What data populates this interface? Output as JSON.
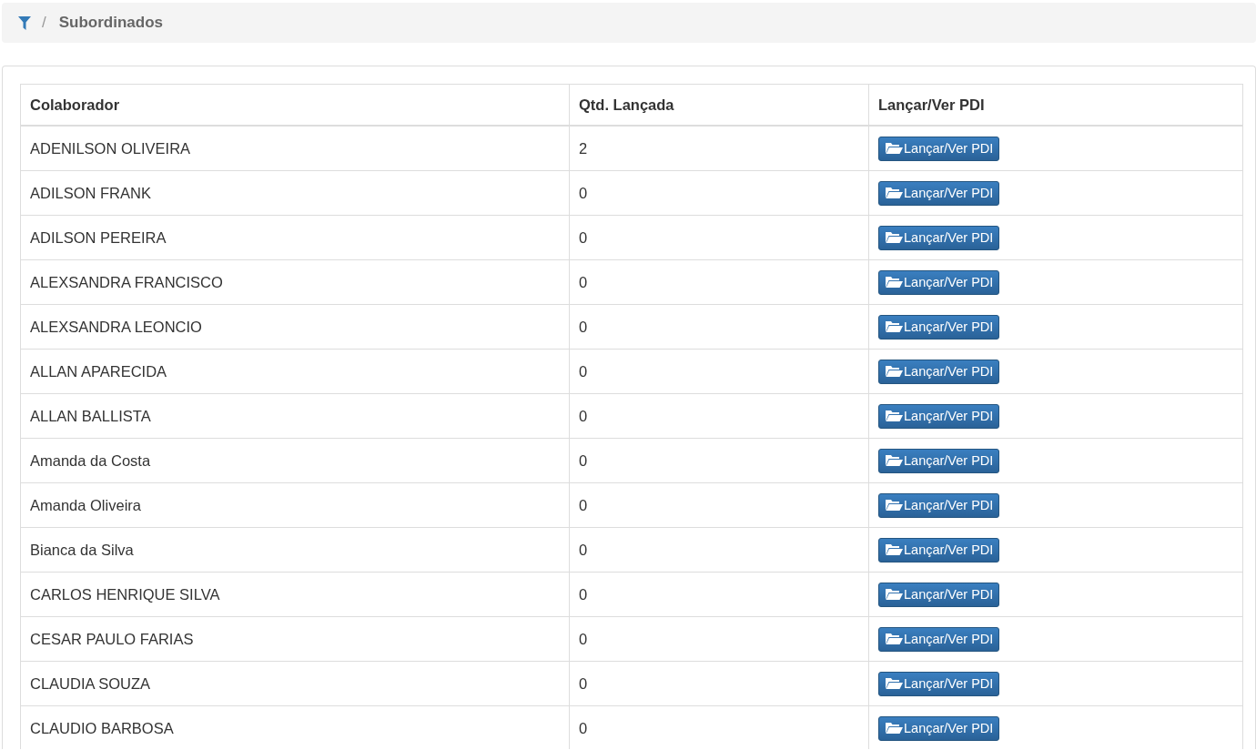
{
  "breadcrumb": {
    "separator": "/",
    "current": "Subordinados"
  },
  "table": {
    "columns": [
      "Colaborador",
      "Qtd. Lançada",
      "Lançar/Ver PDI"
    ],
    "rows": [
      {
        "name": "ADENILSON OLIVEIRA",
        "count": "2",
        "action": "Lançar/Ver PDI"
      },
      {
        "name": "ADILSON FRANK",
        "count": "0",
        "action": "Lançar/Ver PDI"
      },
      {
        "name": "ADILSON PEREIRA",
        "count": "0",
        "action": "Lançar/Ver PDI"
      },
      {
        "name": "ALEXSANDRA FRANCISCO",
        "count": "0",
        "action": "Lançar/Ver PDI"
      },
      {
        "name": "ALEXSANDRA LEONCIO",
        "count": "0",
        "action": "Lançar/Ver PDI"
      },
      {
        "name": "ALLAN APARECIDA",
        "count": "0",
        "action": "Lançar/Ver PDI"
      },
      {
        "name": "ALLAN BALLISTA",
        "count": "0",
        "action": "Lançar/Ver PDI"
      },
      {
        "name": "Amanda da Costa",
        "count": "0",
        "action": "Lançar/Ver PDI"
      },
      {
        "name": "Amanda Oliveira",
        "count": "0",
        "action": "Lançar/Ver PDI"
      },
      {
        "name": "Bianca da Silva",
        "count": "0",
        "action": "Lançar/Ver PDI"
      },
      {
        "name": "CARLOS HENRIQUE SILVA",
        "count": "0",
        "action": "Lançar/Ver PDI"
      },
      {
        "name": "CESAR PAULO FARIAS",
        "count": "0",
        "action": "Lançar/Ver PDI"
      },
      {
        "name": "CLAUDIA SOUZA",
        "count": "0",
        "action": "Lançar/Ver PDI"
      },
      {
        "name": "CLAUDIO BARBOSA",
        "count": "0",
        "action": "Lançar/Ver PDI"
      }
    ]
  }
}
